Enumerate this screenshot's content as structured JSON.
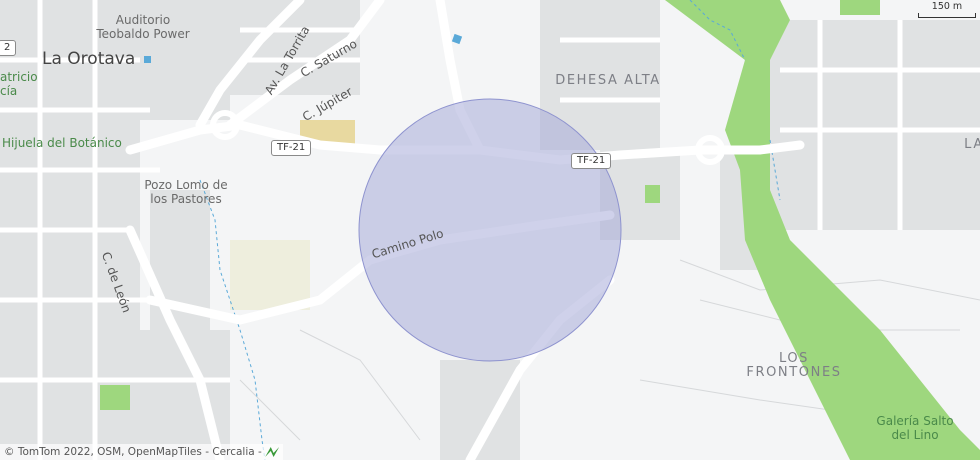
{
  "map": {
    "labels": {
      "auditorio": "Auditorio\nTeobaldo Power",
      "orotava": "La Orotava",
      "patricio": "atricio\ncía",
      "hijuela": "Hijuela del Botánico",
      "pozo": "Pozo Lomo de\nlos Pastores",
      "de_leon": "C. de León",
      "la_torrita": "Av. La Torrita",
      "saturno": "C. Saturno",
      "jupiter": "C. Júpiter",
      "camino_polo": "Camino Polo",
      "dehesa": "DEHESA ALTA",
      "frontones": "LOS\nFRONTONES",
      "galeria": "Galería Salto\ndel Lino",
      "la_edge": "LA",
      "route_two": "2"
    },
    "shields": {
      "tf21_left": "TF-21",
      "tf21_right": "TF-21"
    },
    "scale": {
      "label": "150 m"
    },
    "attribution": "© TomTom 2022, OSM, OpenMapTiles - Cercalia -",
    "colors": {
      "background": "#f4f5f6",
      "blocks": "#e0e2e3",
      "roads": "#ffffff",
      "park": "#9ed77e",
      "area_circle": "#a7acd9",
      "water": "#5aa9d8"
    }
  }
}
